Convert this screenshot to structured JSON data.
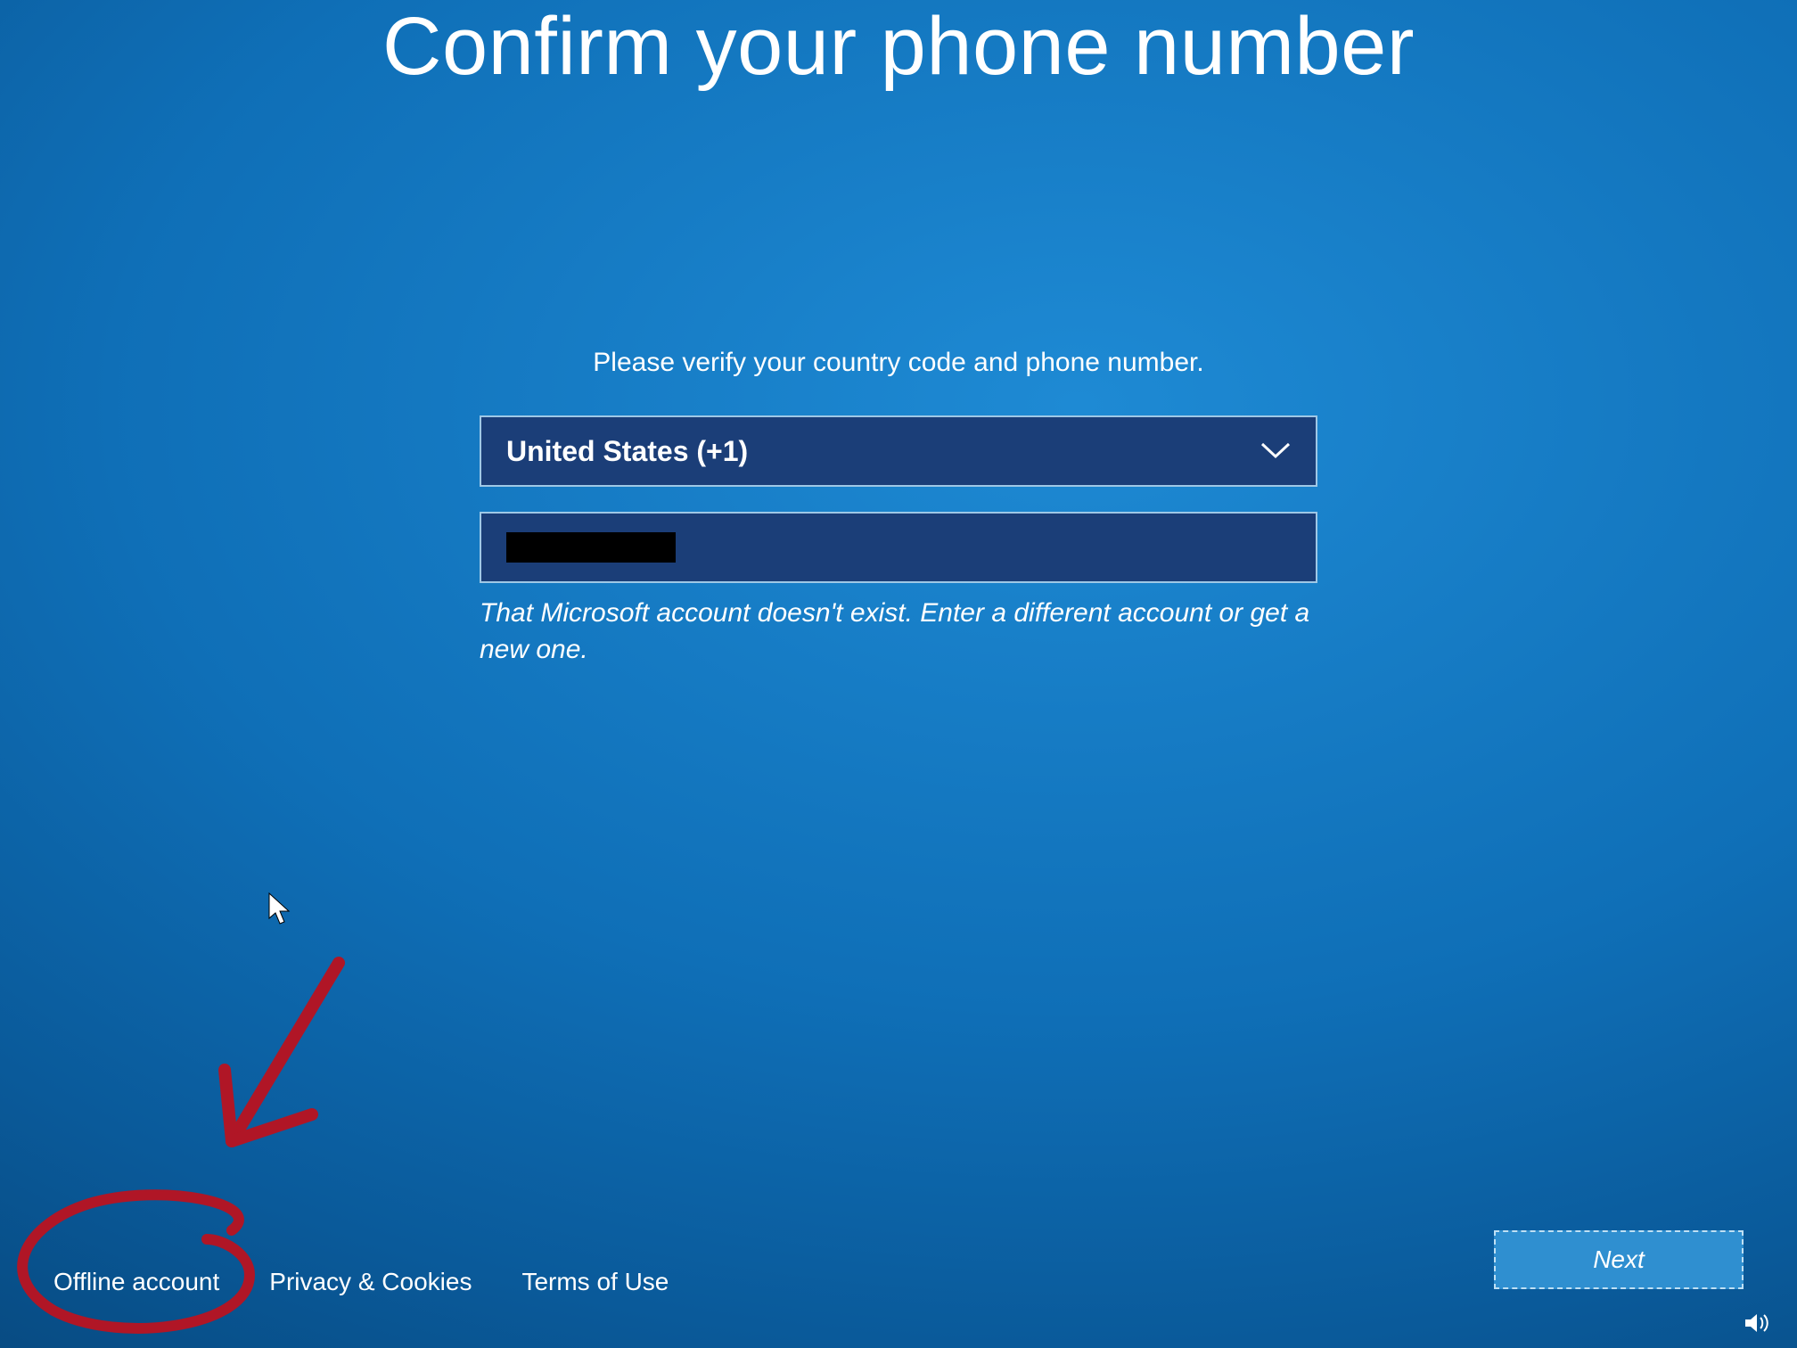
{
  "title": "Confirm your phone number",
  "instruction": "Please verify your country code and phone number.",
  "country_select": {
    "value": "United States (+1)"
  },
  "phone_input": {
    "value": ""
  },
  "error_message": "That Microsoft account doesn't exist. Enter a different account or get a new one.",
  "footer": {
    "offline_account": "Offline account",
    "privacy_cookies": "Privacy & Cookies",
    "terms_of_use": "Terms of Use"
  },
  "next_button": "Next"
}
